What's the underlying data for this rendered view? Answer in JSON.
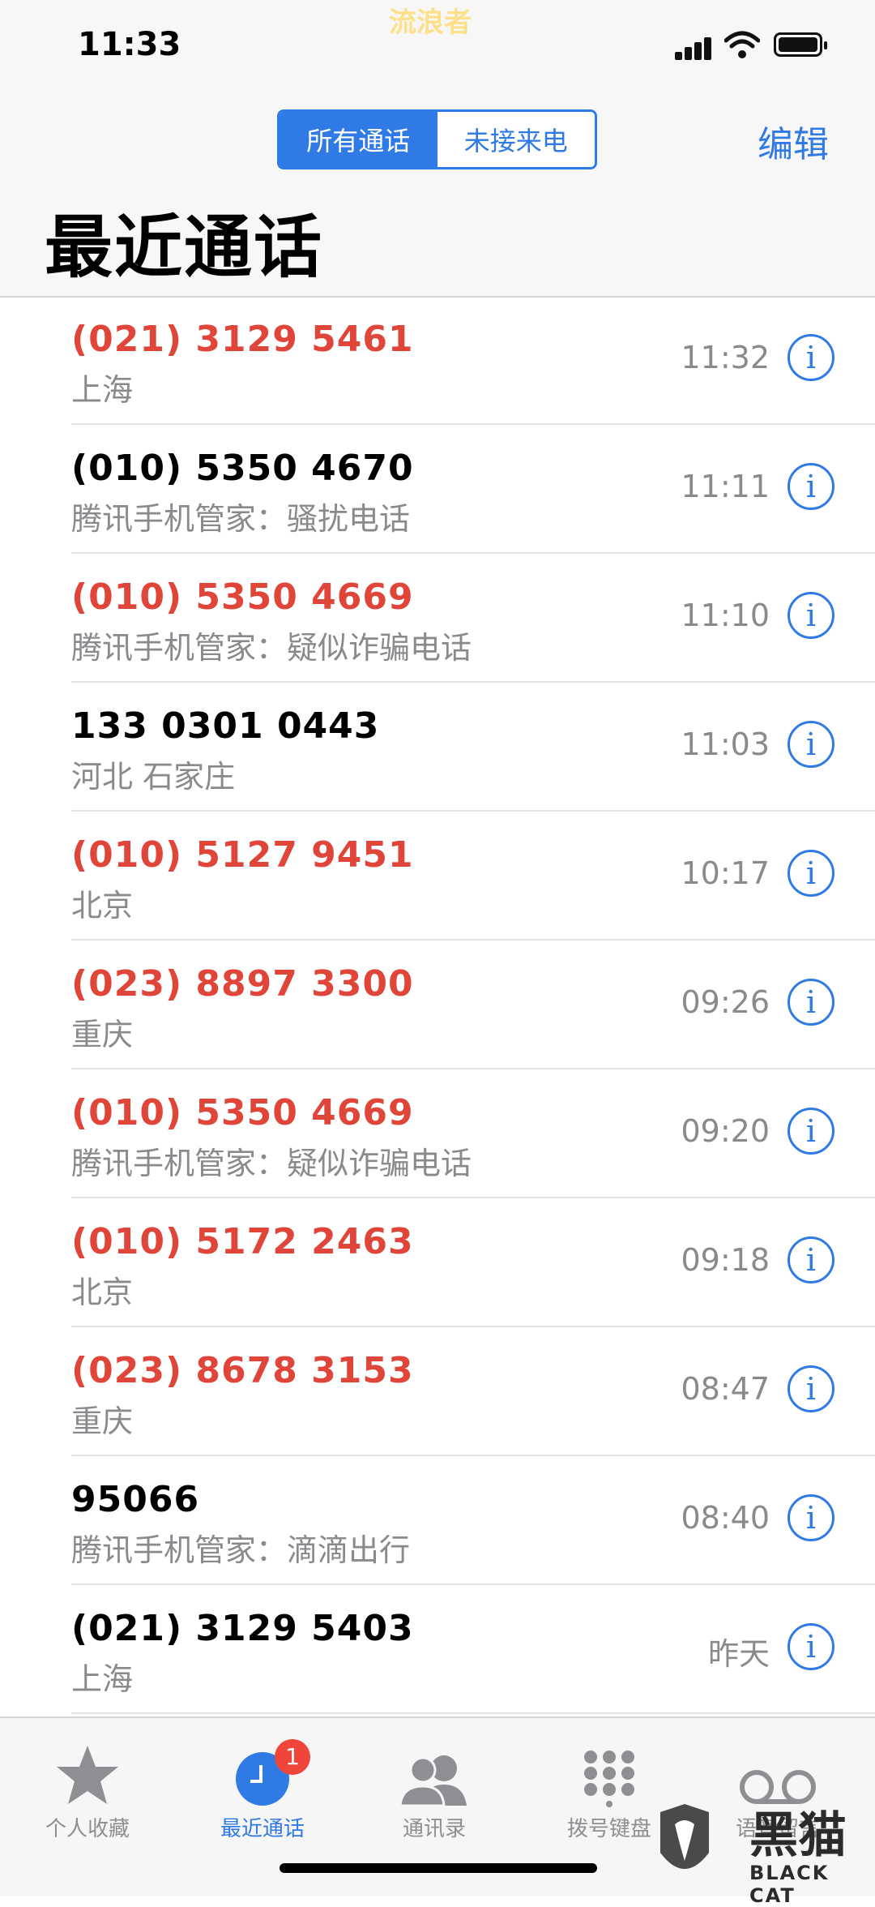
{
  "status": {
    "time": "11:33",
    "watermark": "流浪者"
  },
  "nav": {
    "segments": [
      "所有通话",
      "未接来电"
    ],
    "edit_label": "编辑",
    "title": "最近通话"
  },
  "calls": [
    {
      "number": "(021) 3129 5461",
      "location": "上海",
      "time": "11:32",
      "missed": true
    },
    {
      "number": "(010) 5350 4670",
      "location": "腾讯手机管家：骚扰电话",
      "time": "11:11",
      "missed": false
    },
    {
      "number": "(010) 5350 4669",
      "location": "腾讯手机管家：疑似诈骗电话",
      "time": "11:10",
      "missed": true
    },
    {
      "number": "133 0301 0443",
      "location": "河北 石家庄",
      "time": "11:03",
      "missed": false
    },
    {
      "number": "(010) 5127 9451",
      "location": "北京",
      "time": "10:17",
      "missed": true
    },
    {
      "number": "(023) 8897 3300",
      "location": "重庆",
      "time": "09:26",
      "missed": true
    },
    {
      "number": "(010) 5350 4669",
      "location": "腾讯手机管家：疑似诈骗电话",
      "time": "09:20",
      "missed": true
    },
    {
      "number": "(010) 5172 2463",
      "location": "北京",
      "time": "09:18",
      "missed": true
    },
    {
      "number": "(023) 8678 3153",
      "location": "重庆",
      "time": "08:47",
      "missed": true
    },
    {
      "number": "95066",
      "location": "腾讯手机管家：滴滴出行",
      "time": "08:40",
      "missed": false
    },
    {
      "number": "(021) 3129 5403",
      "location": "上海",
      "time": "昨天",
      "missed": false
    }
  ],
  "info_glyph": "i",
  "tabbar": {
    "tabs": [
      {
        "label": "个人收藏",
        "icon": "star-icon"
      },
      {
        "label": "最近通话",
        "icon": "clock-icon",
        "badge": "1"
      },
      {
        "label": "通讯录",
        "icon": "contacts-icon"
      },
      {
        "label": "拨号键盘",
        "icon": "keypad-icon"
      },
      {
        "label": "语音留言",
        "icon": "voicemail-icon"
      }
    ]
  },
  "watermark_corner": {
    "text": "黑猫",
    "sub": "BLACK CAT"
  },
  "colors": {
    "accent": "#2f7ae5",
    "missed": "#e0453a",
    "secondary": "#8a8a8e"
  }
}
